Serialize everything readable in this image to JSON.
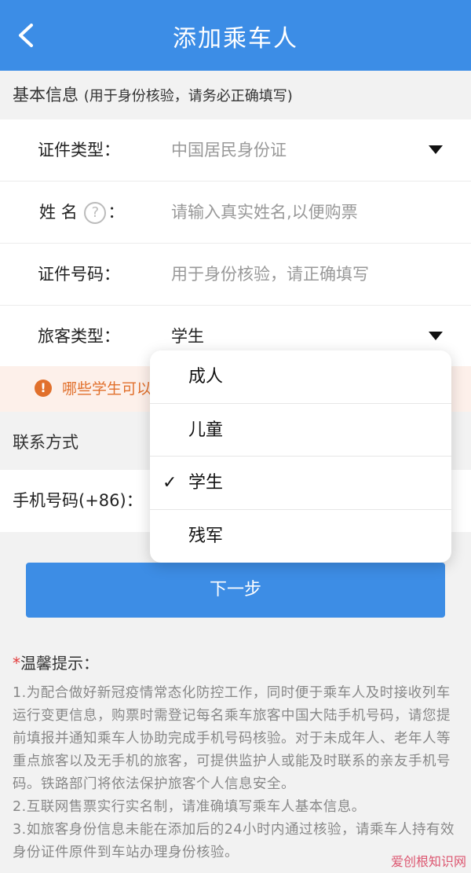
{
  "header": {
    "title": "添加乘车人"
  },
  "basic": {
    "heading": "基本信息",
    "heading_note": "(用于身份核验，请务必正确填写)",
    "rows": [
      {
        "label": "证件类型：",
        "value": "中国居民身份证"
      },
      {
        "label_a": "姓",
        "label_b": "名",
        "help": "?",
        "colon": "：",
        "placeholder": "请输入真实姓名,以便购票"
      },
      {
        "label": "证件号码：",
        "placeholder": "用于身份核验，请正确填写"
      },
      {
        "label": "旅客类型：",
        "value": "学生"
      }
    ]
  },
  "notice": {
    "text": "哪些学生可以"
  },
  "contact": {
    "heading": "联系方式",
    "phone_label": "手机号码(+86)："
  },
  "next_button": "下一步",
  "dropdown": {
    "options": [
      "成人",
      "儿童",
      "学生",
      "残军"
    ],
    "selected": "学生",
    "check": "✓"
  },
  "tips": {
    "star": "*",
    "title": "温馨提示：",
    "paragraphs": [
      "1.为配合做好新冠疫情常态化防控工作，同时便于乘车人及时接收列车运行变更信息，购票时需登记每名乘车旅客中国大陆手机号码，请您提前填报并通知乘车人协助完成手机号码核验。对于未成年人、老年人等重点旅客以及无手机的旅客，可提供监护人或能及时联系的亲友手机号码。铁路部门将依法保护旅客个人信息安全。",
      "2.互联网售票实行实名制，请准确填写乘车人基本信息。",
      "3.如旅客身份信息未能在添加后的24小时内通过核验，请乘车人持有效身份证件原件到车站办理身份核验。"
    ]
  },
  "watermark": "爱创根知识网",
  "colors": {
    "header": "#3c8de6",
    "button": "#3d8de5",
    "notice_text": "#e1702c",
    "notice_bg": "#fdf0ea"
  }
}
